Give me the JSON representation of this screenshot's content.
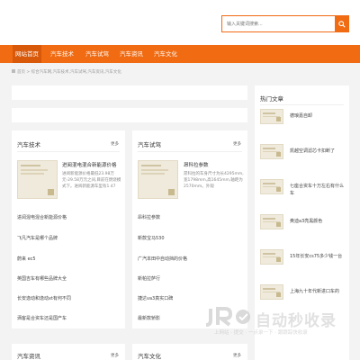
{
  "search": {
    "placeholder": "输入关键词搜索...",
    "icon": "search-icon"
  },
  "nav": [
    {
      "label": "网站首页",
      "active": true
    },
    {
      "label": "汽车技术",
      "active": false
    },
    {
      "label": "汽车试驾",
      "active": false
    },
    {
      "label": "汽车资讯",
      "active": false
    },
    {
      "label": "汽车文化",
      "active": false
    }
  ],
  "breadcrumb": "首页 > 综合汽车网,汽车技术,汽车试驾,汽车资讯,汽车文化",
  "panels": [
    {
      "title": "汽车技术",
      "more": "更多",
      "featured": {
        "title": "进阅混电混合新能源价格",
        "desc": "进阅新能源价格最低23.98万元-29.58万元之间,目前在燃烧模式下。进阅新能源车型有1.47"
      },
      "items": [
        "进阅混电混合新能源价格",
        "飞凡汽车是哪个品牌",
        "蔚来 ec5",
        "英国吉车有哪些品牌大全",
        "长安逸动和逸动xt有何不同",
        "洒客是合资车还是国产车"
      ]
    },
    {
      "title": "汽车试驾",
      "more": "更多",
      "featured": {
        "title": "昂科拉参数",
        "desc": "昂科拉的车身尺寸为长4295mm,宽1798mm,高1645mm,轴距为2570mm。外观"
      },
      "items": [
        "昂科拉参数",
        "新款宝马530",
        "广汽本田中自动挡的价格",
        "新帕拉萨行",
        "捷达va3真实口碑",
        "最新款轿影"
      ]
    }
  ],
  "bottom_panels": [
    {
      "title": "汽车资讯",
      "more": "更多"
    },
    {
      "title": "汽车文化",
      "more": "更多"
    }
  ],
  "hot": {
    "title": "热门文章",
    "items": [
      "德琅嘉自卸",
      "凯越空调滤芯卡扣断了",
      "七座合资车十万左右有什么车",
      "奥迪a3亮黑颜色",
      "15年长安cs75多少钱一台",
      "上海九十年代新进口车的"
    ]
  },
  "watermark": {
    "title": "自动秒收录",
    "subtitle": "上网站 · 提交 · 一点录一下 · 跟跟踪快收录",
    "icon": "jr-logo-icon"
  },
  "colors": {
    "accent": "#f06b12",
    "accent_dark": "#d9590a"
  }
}
